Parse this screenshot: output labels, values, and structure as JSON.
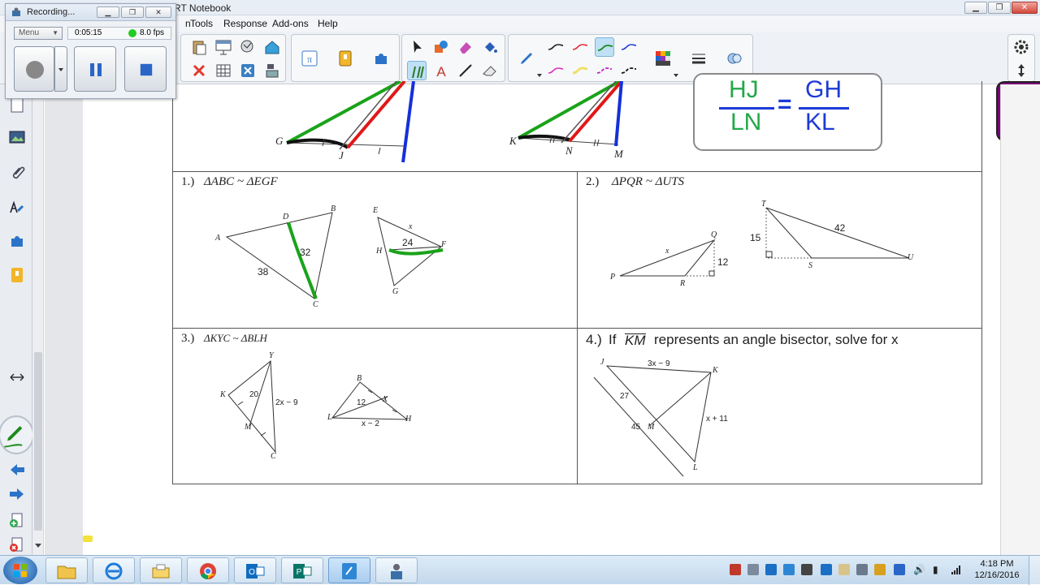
{
  "window": {
    "title": "RT Notebook"
  },
  "menus": [
    "n",
    "Tools",
    "Response",
    "Add-ons",
    "Help"
  ],
  "recorder": {
    "title": "Recording...",
    "menu_label": "Menu",
    "elapsed": "0:05:15",
    "fps": "8.0 fps",
    "status_color": "#22cc22"
  },
  "colors": {
    "green": "#1aa31a",
    "red": "#e01818",
    "blue": "#1530d8",
    "purple": "#7a007a",
    "formula_green": "#23a84a",
    "formula_blue": "#1d3ad6"
  },
  "formula": {
    "top_left": "HJ",
    "bottom_left": "LN",
    "top_right": "GH",
    "bottom_right": "KL",
    "equals": "="
  },
  "top_figure": {
    "left_labels": [
      "G",
      "J"
    ],
    "right_labels": [
      "K",
      "N",
      "M"
    ]
  },
  "problems": {
    "p1": {
      "num": "1.)",
      "statement": "ΔABC ~ ΔEGF",
      "labels": {
        "A": "A",
        "B": "B",
        "C": "C",
        "D": "D",
        "E": "E",
        "F": "F",
        "G": "G",
        "H": "H",
        "x": "x"
      },
      "values": {
        "v32": "32",
        "v38": "38",
        "v24": "24"
      }
    },
    "p2": {
      "num": "2.)",
      "statement": "ΔPQR ~ ΔUTS",
      "labels": {
        "P": "P",
        "Q": "Q",
        "R": "R",
        "T": "T",
        "S": "S",
        "U": "U",
        "x": "x"
      },
      "values": {
        "v12": "12",
        "v15": "15",
        "v42": "42"
      }
    },
    "p3": {
      "num": "3.)",
      "statement": "ΔKYC ~ ΔBLH",
      "labels": {
        "Y": "Y",
        "K": "K",
        "M": "M",
        "C": "C",
        "B": "B",
        "L": "L",
        "H": "H",
        "X": "X"
      },
      "values": {
        "v20": "20",
        "e1": "2x − 9",
        "v12": "12",
        "e2": "x − 2"
      }
    },
    "p4": {
      "num": "4.)",
      "pre": "If",
      "seg": "KM",
      "post": "represents an angle bisector, solve for x",
      "labels": {
        "J": "J",
        "K": "K",
        "M": "M",
        "L": "L"
      },
      "values": {
        "e1": "3x − 9",
        "v27": "27",
        "v45": "45",
        "e2": "x + 11"
      }
    }
  },
  "taskbar": {
    "time": "4:18 PM",
    "date": "12/16/2016"
  }
}
